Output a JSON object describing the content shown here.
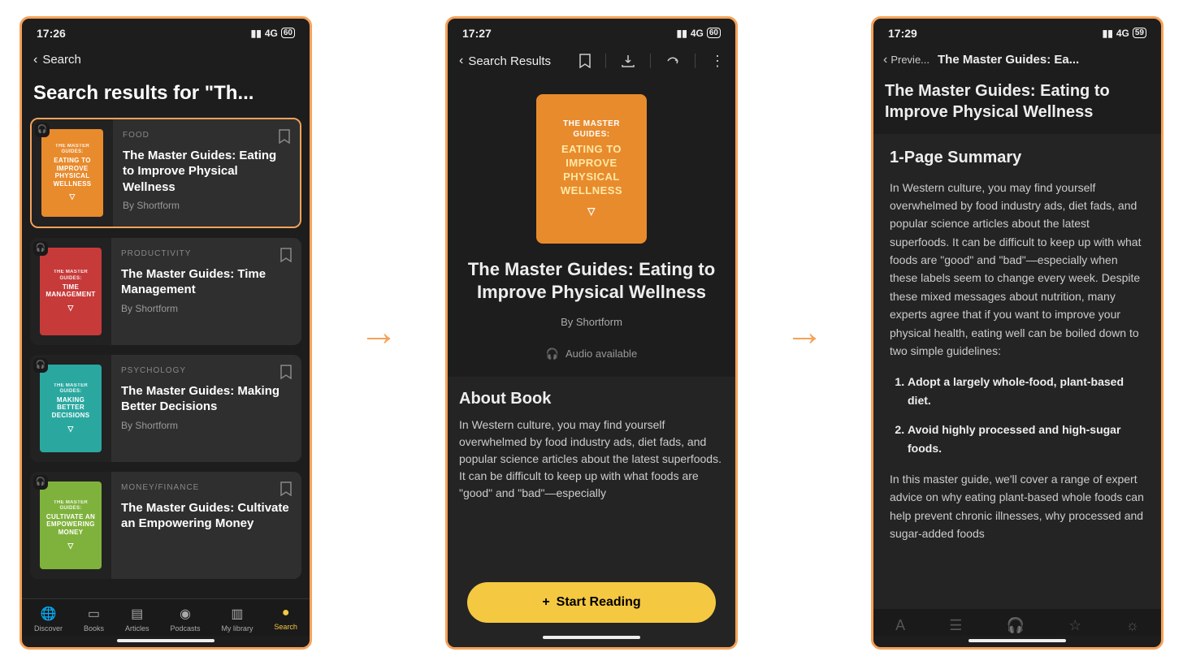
{
  "colors": {
    "accent": "#f5a25a",
    "yellow": "#f5c842",
    "card_orange": "#e88b2d",
    "card_red": "#c73a3a",
    "card_teal": "#2aa8a0",
    "card_green": "#7fb23c"
  },
  "screen1": {
    "status": {
      "time": "17:26",
      "network": "4G",
      "battery": "60"
    },
    "back_label": "Search",
    "heading": "Search results for \"Th...",
    "results": [
      {
        "category": "FOOD",
        "title": "The Master Guides: Eating to Improve Physical Wellness",
        "author": "By Shortform",
        "cover_line1": "THE MASTER GUIDES:",
        "cover_line2": "EATING TO IMPROVE PHYSICAL WELLNESS",
        "cover_color": "#e88b2d",
        "highlighted": true
      },
      {
        "category": "PRODUCTIVITY",
        "title": "The Master Guides: Time Management",
        "author": "By Shortform",
        "cover_line1": "THE MASTER GUIDES:",
        "cover_line2": "TIME MANAGEMENT",
        "cover_color": "#c73a3a",
        "highlighted": false
      },
      {
        "category": "PSYCHOLOGY",
        "title": "The Master Guides: Making Better Decisions",
        "author": "By Shortform",
        "cover_line1": "THE MASTER GUIDES:",
        "cover_line2": "MAKING BETTER DECISIONS",
        "cover_color": "#2aa8a0",
        "highlighted": false
      },
      {
        "category": "MONEY/FINANCE",
        "title": "The Master Guides: Cultivate an Empowering Money",
        "author": "By Shortform",
        "cover_line1": "THE MASTER GUIDES:",
        "cover_line2": "CULTIVATE AN EMPOWERING MONEY",
        "cover_color": "#7fb23c",
        "highlighted": false
      }
    ],
    "nav": {
      "items": [
        {
          "label": "Discover",
          "icon": "globe"
        },
        {
          "label": "Books",
          "icon": "book"
        },
        {
          "label": "Articles",
          "icon": "article"
        },
        {
          "label": "Podcasts",
          "icon": "podcast"
        },
        {
          "label": "My library",
          "icon": "library"
        },
        {
          "label": "Search",
          "icon": "search",
          "active": true
        }
      ]
    }
  },
  "screen2": {
    "status": {
      "time": "17:27",
      "network": "4G",
      "battery": "60"
    },
    "back_label": "Search Results",
    "cover": {
      "line1": "THE MASTER GUIDES:",
      "line2": "EATING TO IMPROVE PHYSICAL WELLNESS",
      "color": "#e88b2d"
    },
    "title": "The Master Guides: Eating to Improve Physical Wellness",
    "author": "By Shortform",
    "audio_label": "Audio available",
    "about_heading": "About Book",
    "about_text": "In Western culture, you may find yourself overwhelmed by food industry ads, diet fads, and popular science articles about the latest superfoods. It can be difficult to keep up with what foods are \"good\" and \"bad\"—especially",
    "start_button": "Start Reading"
  },
  "screen3": {
    "status": {
      "time": "17:29",
      "network": "4G",
      "battery": "59"
    },
    "back_label": "Previe...",
    "header_title": "The Master Guides: Ea...",
    "article_title": "The Master Guides: Eating to Improve Physical Wellness",
    "summary_heading": "1-Page Summary",
    "para1": "In Western culture, you may find yourself overwhelmed by food industry ads, diet fads, and popular science articles about the latest superfoods. It can be difficult to keep up with what foods are \"good\" and \"bad\"—especially when these labels seem to change every week. Despite these mixed messages about nutrition, many experts agree that if you want to improve your physical health, eating well can be boiled down to two simple guidelines:",
    "bullets": [
      "Adopt a largely whole-food, plant-based diet.",
      "Avoid highly processed and high-sugar foods."
    ],
    "para2": "In this master guide, we'll cover a range of expert advice on why eating plant-based whole foods can help prevent chronic illnesses, why processed and sugar-added foods"
  }
}
